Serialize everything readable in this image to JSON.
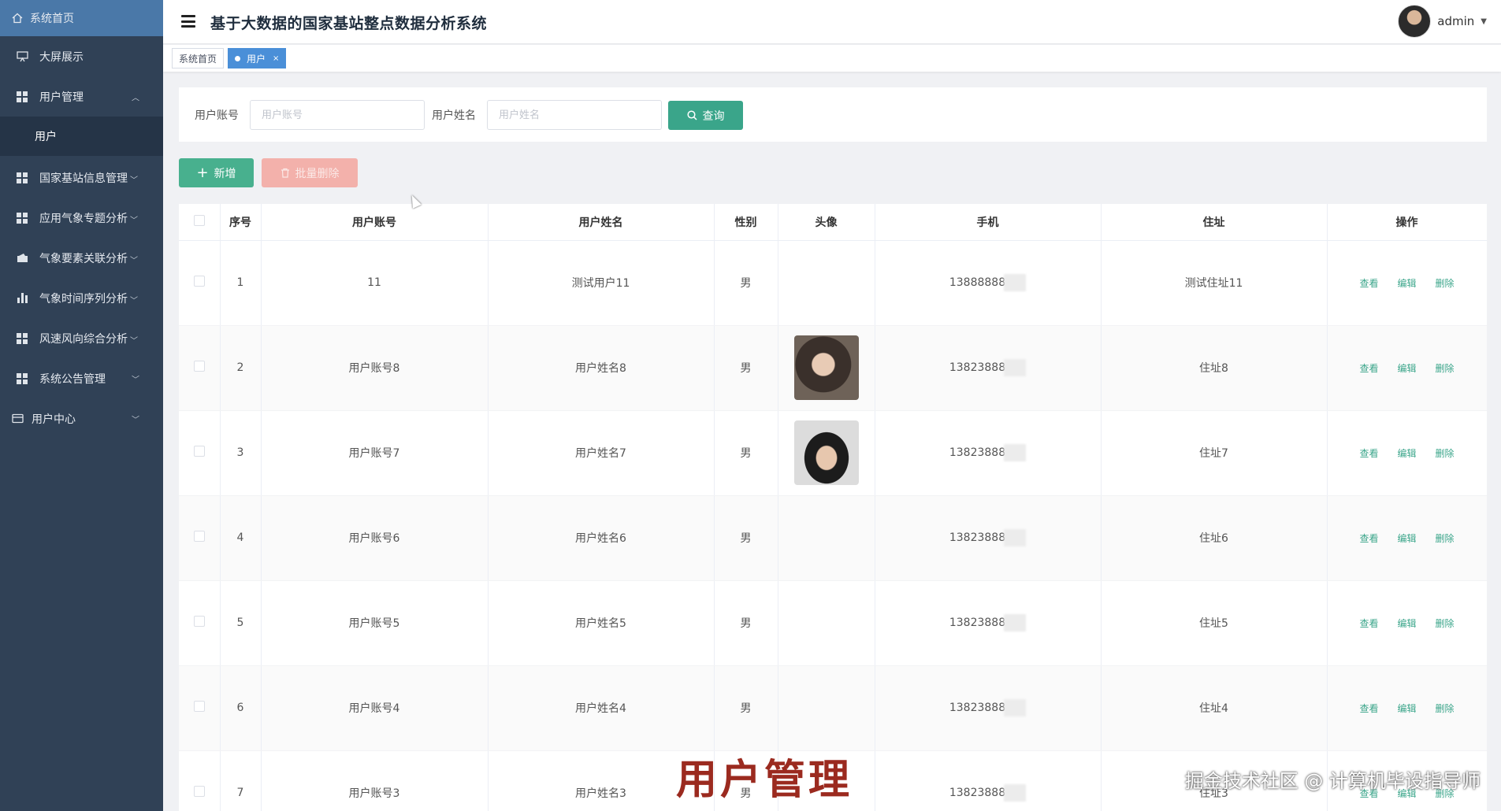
{
  "app": {
    "title": "基于大数据的国家基站整点数据分析系统",
    "user_name": "admin"
  },
  "sidebar": {
    "items": [
      {
        "label": "系统首页",
        "icon": "home-icon"
      },
      {
        "label": "大屏展示",
        "icon": "screen-icon"
      },
      {
        "label": "用户管理",
        "icon": "grid-icon",
        "expanded": true
      },
      {
        "label": "用户",
        "icon": ""
      },
      {
        "label": "国家基站信息管理",
        "icon": "grid-icon"
      },
      {
        "label": "应用气象专题分析",
        "icon": "grid-icon"
      },
      {
        "label": "气象要素关联分析",
        "icon": "wallet-icon"
      },
      {
        "label": "气象时间序列分析",
        "icon": "bar-chart-icon"
      },
      {
        "label": "风速风向综合分析",
        "icon": "grid-icon"
      },
      {
        "label": "系统公告管理",
        "icon": "grid-icon"
      },
      {
        "label": "用户中心",
        "icon": "card-icon"
      }
    ]
  },
  "tags": [
    {
      "label": "系统首页",
      "active": false
    },
    {
      "label": "用户",
      "active": true,
      "close": "×"
    }
  ],
  "search": {
    "account_label": "用户账号",
    "account_placeholder": "用户账号",
    "name_label": "用户姓名",
    "name_placeholder": "用户姓名",
    "query_label": "查询"
  },
  "actions": {
    "add_label": "新增",
    "batch_delete_label": "批量删除"
  },
  "table": {
    "headers": [
      "序号",
      "用户账号",
      "用户姓名",
      "性别",
      "头像",
      "手机",
      "住址",
      "操作"
    ],
    "ops": {
      "view": "查看",
      "edit": "编辑",
      "delete": "删除"
    },
    "rows": [
      {
        "index": "1",
        "account": "11",
        "name": "测试用户11",
        "gender": "男",
        "avatar": "",
        "phone": "13888888",
        "address": "测试住址11"
      },
      {
        "index": "2",
        "account": "用户账号8",
        "name": "用户姓名8",
        "gender": "男",
        "avatar": "girl",
        "phone": "13823888",
        "address": "住址8"
      },
      {
        "index": "3",
        "account": "用户账号7",
        "name": "用户姓名7",
        "gender": "男",
        "avatar": "boy",
        "phone": "13823888",
        "address": "住址7"
      },
      {
        "index": "4",
        "account": "用户账号6",
        "name": "用户姓名6",
        "gender": "男",
        "avatar": "",
        "phone": "13823888",
        "address": "住址6"
      },
      {
        "index": "5",
        "account": "用户账号5",
        "name": "用户姓名5",
        "gender": "男",
        "avatar": "",
        "phone": "13823888",
        "address": "住址5"
      },
      {
        "index": "6",
        "account": "用户账号4",
        "name": "用户姓名4",
        "gender": "男",
        "avatar": "",
        "phone": "13823888",
        "address": "住址4"
      },
      {
        "index": "7",
        "account": "用户账号3",
        "name": "用户姓名3",
        "gender": "男",
        "avatar": "",
        "phone": "13823888",
        "address": "住址3"
      }
    ]
  },
  "overlay": {
    "caption": "用户管理",
    "credit": "掘金技术社区 @ 计算机毕设指导师"
  },
  "colors": {
    "sidebar_bg": "#304156",
    "sidebar_active": "#4a78a8",
    "primary_green": "#3aa58a",
    "danger_light": "#f3b1ab",
    "tag_active": "#4a8fd8"
  }
}
